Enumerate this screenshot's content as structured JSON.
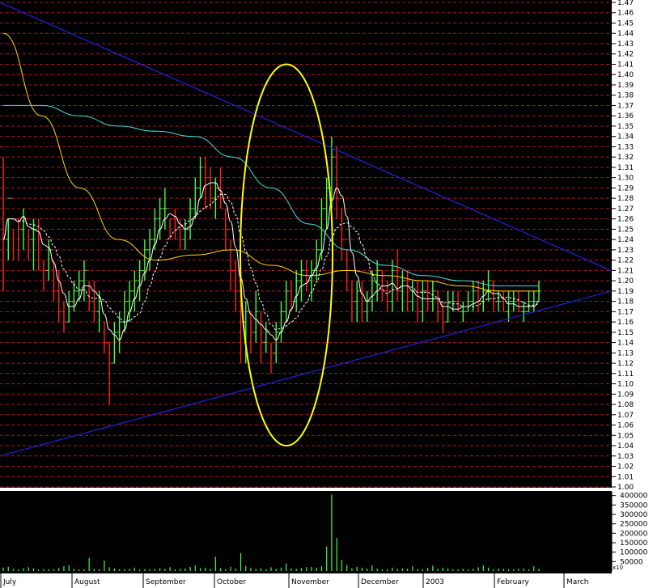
{
  "chart_data": {
    "type": "candlestick",
    "price_axis": {
      "ylim": [
        1.0,
        1.47
      ],
      "tick_labels": [
        "1.00",
        "1.01",
        "1.02",
        "1.03",
        "1.04",
        "1.05",
        "1.06",
        "1.07",
        "1.08",
        "1.09",
        "1.10",
        "1.11",
        "1.12",
        "1.13",
        "1.14",
        "1.15",
        "1.16",
        "1.17",
        "1.18",
        "1.19",
        "1.20",
        "1.21",
        "1.22",
        "1.23",
        "1.24",
        "1.25",
        "1.26",
        "1.27",
        "1.28",
        "1.29",
        "1.30",
        "1.31",
        "1.32",
        "1.33",
        "1.34",
        "1.35",
        "1.36",
        "1.37",
        "1.38",
        "1.39",
        "1.40",
        "1.41",
        "1.42",
        "1.43",
        "1.44",
        "1.45",
        "1.46",
        "1.47"
      ]
    },
    "volume_axis": {
      "ylim": [
        0,
        420000
      ],
      "tick_labels": [
        "50000",
        "100000",
        "150000",
        "200000",
        "250000",
        "300000",
        "350000",
        "400000"
      ],
      "multiplier_label": "x10"
    },
    "x_axis": {
      "labels": [
        "July",
        "August",
        "September",
        "October",
        "November",
        "December",
        "2003",
        "February",
        "March"
      ]
    },
    "bars": [
      [
        1.33,
        1.32,
        1.19,
        1.24
      ],
      [
        1.24,
        1.26,
        1.22,
        1.28
      ],
      [
        1.28,
        1.25,
        1.22,
        1.26
      ],
      [
        1.26,
        1.26,
        1.22,
        1.25
      ],
      [
        1.25,
        1.27,
        1.23,
        1.26
      ],
      [
        1.26,
        1.25,
        1.22,
        1.24
      ],
      [
        1.24,
        1.26,
        1.21,
        1.25
      ],
      [
        1.25,
        1.26,
        1.21,
        1.24
      ],
      [
        1.24,
        1.22,
        1.19,
        1.21
      ],
      [
        1.21,
        1.24,
        1.2,
        1.23
      ],
      [
        1.23,
        1.22,
        1.18,
        1.19
      ],
      [
        1.19,
        1.21,
        1.16,
        1.17
      ],
      [
        1.17,
        1.18,
        1.15,
        1.16
      ],
      [
        1.16,
        1.19,
        1.16,
        1.18
      ],
      [
        1.18,
        1.2,
        1.17,
        1.19
      ],
      [
        1.19,
        1.21,
        1.18,
        1.2
      ],
      [
        1.2,
        1.22,
        1.18,
        1.21
      ],
      [
        1.21,
        1.2,
        1.17,
        1.18
      ],
      [
        1.18,
        1.2,
        1.16,
        1.17
      ],
      [
        1.17,
        1.19,
        1.15,
        1.18
      ],
      [
        1.18,
        1.16,
        1.13,
        1.14
      ],
      [
        1.14,
        1.14,
        1.08,
        1.12
      ],
      [
        1.12,
        1.16,
        1.12,
        1.15
      ],
      [
        1.15,
        1.17,
        1.13,
        1.16
      ],
      [
        1.16,
        1.19,
        1.15,
        1.18
      ],
      [
        1.18,
        1.2,
        1.16,
        1.19
      ],
      [
        1.19,
        1.21,
        1.17,
        1.2
      ],
      [
        1.2,
        1.22,
        1.18,
        1.21
      ],
      [
        1.21,
        1.24,
        1.2,
        1.23
      ],
      [
        1.23,
        1.25,
        1.21,
        1.24
      ],
      [
        1.24,
        1.27,
        1.23,
        1.26
      ],
      [
        1.26,
        1.28,
        1.24,
        1.27
      ],
      [
        1.27,
        1.29,
        1.25,
        1.27
      ],
      [
        1.27,
        1.26,
        1.24,
        1.26
      ],
      [
        1.26,
        1.27,
        1.24,
        1.25
      ],
      [
        1.25,
        1.26,
        1.23,
        1.24
      ],
      [
        1.24,
        1.26,
        1.23,
        1.25
      ],
      [
        1.25,
        1.28,
        1.24,
        1.27
      ],
      [
        1.27,
        1.3,
        1.26,
        1.29
      ],
      [
        1.29,
        1.32,
        1.28,
        1.31
      ],
      [
        1.31,
        1.32,
        1.27,
        1.3
      ],
      [
        1.3,
        1.31,
        1.27,
        1.28
      ],
      [
        1.28,
        1.3,
        1.26,
        1.29
      ],
      [
        1.29,
        1.31,
        1.27,
        1.28
      ],
      [
        1.28,
        1.27,
        1.23,
        1.25
      ],
      [
        1.25,
        1.24,
        1.19,
        1.21
      ],
      [
        1.21,
        1.22,
        1.17,
        1.19
      ],
      [
        1.19,
        1.2,
        1.12,
        1.16
      ],
      [
        1.16,
        1.18,
        1.12,
        1.17
      ],
      [
        1.17,
        1.17,
        1.13,
        1.15
      ],
      [
        1.15,
        1.19,
        1.14,
        1.17
      ],
      [
        1.17,
        1.17,
        1.12,
        1.14
      ],
      [
        1.14,
        1.16,
        1.13,
        1.15
      ],
      [
        1.15,
        1.14,
        1.11,
        1.13
      ],
      [
        1.13,
        1.16,
        1.12,
        1.15
      ],
      [
        1.15,
        1.18,
        1.14,
        1.17
      ],
      [
        1.17,
        1.2,
        1.16,
        1.19
      ],
      [
        1.19,
        1.2,
        1.17,
        1.18
      ],
      [
        1.18,
        1.21,
        1.17,
        1.2
      ],
      [
        1.2,
        1.22,
        1.18,
        1.21
      ],
      [
        1.21,
        1.22,
        1.19,
        1.2
      ],
      [
        1.2,
        1.22,
        1.18,
        1.21
      ],
      [
        1.21,
        1.24,
        1.2,
        1.23
      ],
      [
        1.23,
        1.28,
        1.22,
        1.27
      ],
      [
        1.27,
        1.3,
        1.25,
        1.29
      ],
      [
        1.29,
        1.34,
        1.27,
        1.32
      ],
      [
        1.32,
        1.33,
        1.26,
        1.28
      ],
      [
        1.28,
        1.27,
        1.22,
        1.24
      ],
      [
        1.24,
        1.23,
        1.19,
        1.21
      ],
      [
        1.21,
        1.2,
        1.16,
        1.18
      ],
      [
        1.18,
        1.2,
        1.16,
        1.19
      ],
      [
        1.19,
        1.2,
        1.16,
        1.17
      ],
      [
        1.17,
        1.19,
        1.16,
        1.18
      ],
      [
        1.18,
        1.21,
        1.17,
        1.2
      ],
      [
        1.2,
        1.22,
        1.18,
        1.21
      ],
      [
        1.21,
        1.21,
        1.18,
        1.19
      ],
      [
        1.19,
        1.2,
        1.17,
        1.18
      ],
      [
        1.18,
        1.22,
        1.17,
        1.21
      ],
      [
        1.21,
        1.23,
        1.18,
        1.19
      ],
      [
        1.19,
        1.21,
        1.17,
        1.2
      ],
      [
        1.2,
        1.21,
        1.17,
        1.18
      ],
      [
        1.18,
        1.2,
        1.17,
        1.19
      ],
      [
        1.19,
        1.2,
        1.16,
        1.17
      ],
      [
        1.17,
        1.2,
        1.16,
        1.19
      ],
      [
        1.19,
        1.2,
        1.17,
        1.18
      ],
      [
        1.18,
        1.2,
        1.17,
        1.19
      ],
      [
        1.19,
        1.19,
        1.16,
        1.17
      ],
      [
        1.17,
        1.18,
        1.15,
        1.16
      ],
      [
        1.16,
        1.19,
        1.16,
        1.18
      ],
      [
        1.18,
        1.19,
        1.17,
        1.18
      ],
      [
        1.18,
        1.19,
        1.17,
        1.17
      ],
      [
        1.17,
        1.18,
        1.16,
        1.17
      ],
      [
        1.17,
        1.19,
        1.17,
        1.18
      ],
      [
        1.18,
        1.2,
        1.17,
        1.19
      ],
      [
        1.19,
        1.2,
        1.17,
        1.18
      ],
      [
        1.18,
        1.2,
        1.17,
        1.19
      ],
      [
        1.19,
        1.21,
        1.18,
        1.2
      ],
      [
        1.2,
        1.2,
        1.17,
        1.18
      ],
      [
        1.18,
        1.19,
        1.17,
        1.18
      ],
      [
        1.18,
        1.19,
        1.17,
        1.17
      ],
      [
        1.17,
        1.19,
        1.16,
        1.18
      ],
      [
        1.18,
        1.19,
        1.17,
        1.18
      ],
      [
        1.18,
        1.19,
        1.17,
        1.17
      ],
      [
        1.17,
        1.18,
        1.16,
        1.17
      ],
      [
        1.17,
        1.19,
        1.17,
        1.18
      ],
      [
        1.18,
        1.19,
        1.17,
        1.18
      ],
      [
        1.18,
        1.2,
        1.18,
        1.19
      ]
    ],
    "moving_averages": [
      {
        "color": "#ffd700",
        "values_sample": [
          1.44,
          1.36,
          1.29,
          1.24,
          1.22,
          1.225,
          1.23,
          1.215,
          1.205,
          1.21,
          1.205,
          1.2,
          1.195,
          1.19,
          1.19
        ]
      },
      {
        "color": "#40e0e0",
        "values_sample": [
          1.37,
          1.37,
          1.36,
          1.35,
          1.345,
          1.34,
          1.32,
          1.29,
          1.255,
          1.23,
          1.215,
          1.205,
          1.2,
          1.195,
          1.195
        ]
      },
      {
        "color": "#ffffff",
        "style": "solid"
      },
      {
        "color": "#ffffff",
        "style": "dashed"
      }
    ],
    "trendlines": [
      {
        "color": "#2020d0",
        "from": {
          "bar": 0,
          "value": 1.47
        },
        "to": {
          "bar": "end",
          "value": 1.21
        }
      },
      {
        "color": "#2020d0",
        "from": {
          "bar": 0,
          "value": 1.03
        },
        "to": {
          "bar": "end",
          "value": 1.19
        }
      }
    ],
    "highlight": {
      "shape": "ellipse",
      "color": "#ffff00",
      "value_range": [
        1.04,
        1.41
      ]
    },
    "volume": [
      18000,
      22000,
      12000,
      9000,
      15000,
      20000,
      14000,
      8000,
      11000,
      10000,
      9000,
      16000,
      25000,
      30000,
      12000,
      8000,
      9000,
      70000,
      12000,
      10000,
      55000,
      20000,
      14000,
      9000,
      10000,
      12000,
      18000,
      8000,
      10000,
      9000,
      11000,
      15000,
      12000,
      20000,
      9000,
      12000,
      14000,
      22000,
      30000,
      15000,
      18000,
      12000,
      75000,
      16000,
      10000,
      22000,
      14000,
      95000,
      28000,
      18000,
      12000,
      15000,
      10000,
      20000,
      12000,
      18000,
      40000,
      14000,
      12000,
      16000,
      20000,
      22000,
      18000,
      25000,
      130000,
      405000,
      175000,
      60000,
      32000,
      15000,
      22000,
      18000,
      14000,
      30000,
      12000,
      8000,
      10000,
      18000,
      12000,
      14000,
      12000,
      25000,
      10000,
      9000,
      16000,
      28000,
      12000,
      18000,
      14000,
      10000,
      9000,
      12000,
      8000,
      12000,
      20000,
      30000,
      18000,
      10000,
      14000,
      12000,
      10000,
      9000,
      12000,
      14000,
      9000,
      25000,
      12000
    ]
  }
}
